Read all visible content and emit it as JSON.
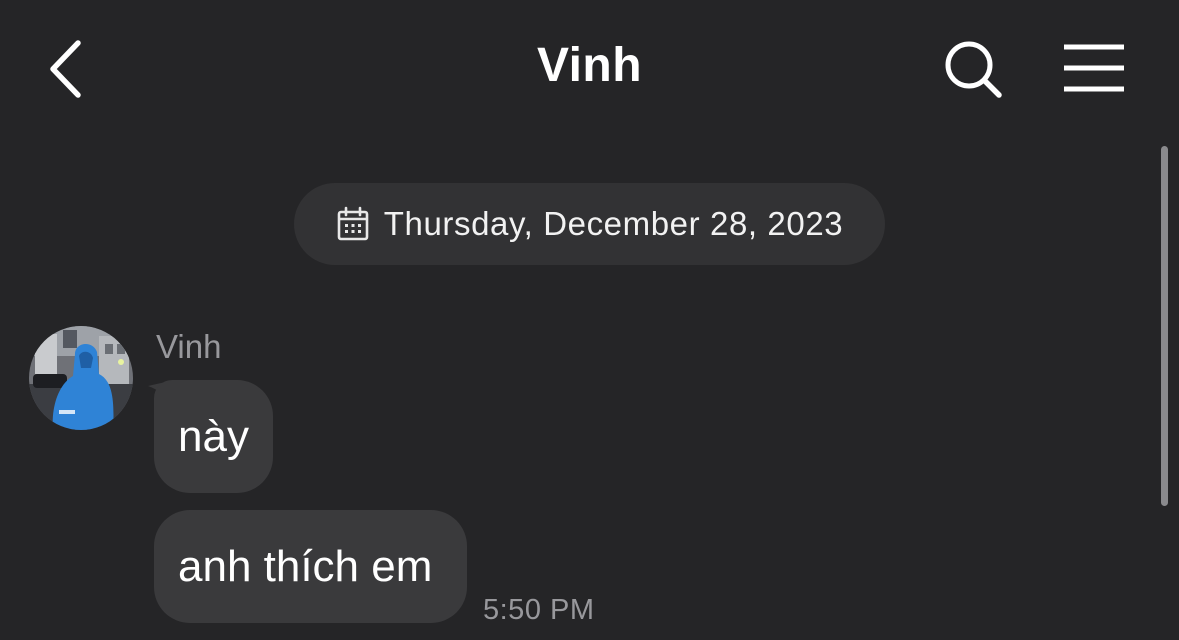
{
  "header": {
    "title": "Vinh",
    "back_icon": "chevron-left-icon",
    "search_icon": "search-icon",
    "menu_icon": "hamburger-menu-icon"
  },
  "conversation": {
    "date_separator": {
      "icon": "calendar-icon",
      "text": "Thursday, December 28, 2023"
    },
    "messages": [
      {
        "sender": "Vinh",
        "avatar": "avatar-photo",
        "text": "này"
      },
      {
        "sender": "Vinh",
        "text": "anh thích em",
        "time": "5:50 PM"
      }
    ]
  },
  "colors": {
    "background": "#252527",
    "bubble": "#3a3a3c",
    "pill": "#323234",
    "muted_text": "#98989c"
  }
}
